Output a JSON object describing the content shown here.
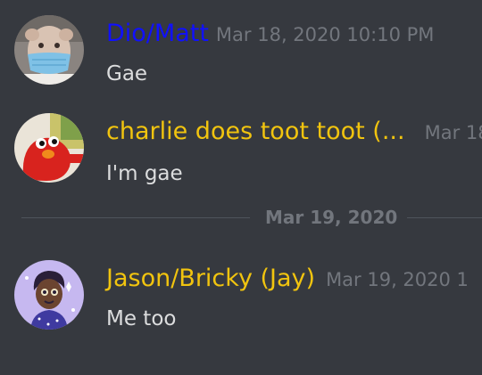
{
  "colors": {
    "background": "#36393f",
    "timestamp": "#72767d",
    "message_text": "#dcddde",
    "divider": "#4f545c",
    "username_blue": "#1010ff",
    "username_yellow": "#f1c40f"
  },
  "messages": [
    {
      "username": "Dio/Matt",
      "username_color": "#1010ff",
      "timestamp": "Mar 18, 2020 10:10 PM",
      "content": "Gae",
      "avatar_icon": "masked-face-avatar"
    },
    {
      "username": "charlie does toot toot (...",
      "username_color": "#f1c40f",
      "timestamp": "Mar 18",
      "content": "I'm gae",
      "avatar_icon": "red-creature-avatar"
    },
    {
      "username": "Jason/Bricky (Jay)",
      "username_color": "#f1c40f",
      "timestamp": "Mar 19, 2020 1",
      "content": "Me too",
      "avatar_icon": "cartoon-person-avatar"
    }
  ],
  "date_divider": {
    "label": "Mar 19, 2020"
  }
}
